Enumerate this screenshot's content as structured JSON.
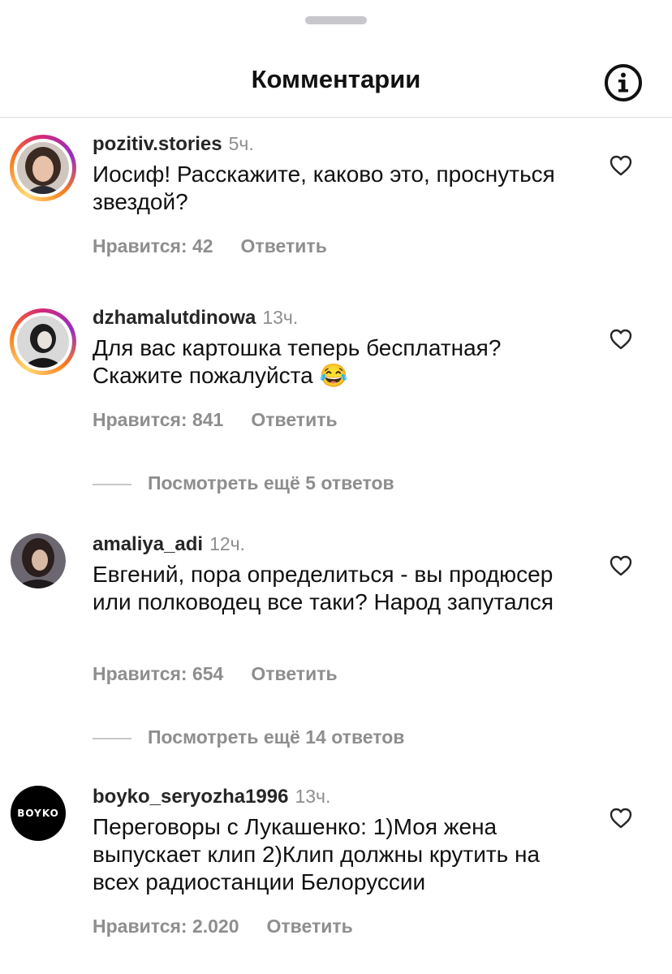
{
  "header": {
    "title": "Комментарии"
  },
  "comments": [
    {
      "username": "pozitiv.stories",
      "time": "5ч.",
      "text": "Иосиф! Расскажите, каково это, проснуться звездой?",
      "likes": "Нравится: 42",
      "reply": "Ответить"
    },
    {
      "username": "dzhamalutdinowa",
      "time": "13ч.",
      "text": "Для вас картошка теперь бесплатная? Скажите пожалуйста 😂",
      "likes": "Нравится: 841",
      "reply": "Ответить",
      "more_replies": "Посмотреть ещё 5 ответов"
    },
    {
      "username": "amaliya_adi",
      "time": "12ч.",
      "text": "Евгений, пора определиться - вы продюсер или полководец все таки? Народ запутался",
      "likes": "Нравится: 654",
      "reply": "Ответить",
      "more_replies": "Посмотреть ещё 14 ответов"
    },
    {
      "username": "boyko_seryozha1996",
      "time": "13ч.",
      "text": "Переговоры с Лукашенко:  1)Моя жена выпускает клип 2)Клип должны крутить на всех радиостанции Белоруссии",
      "likes": "Нравится: 2.020",
      "reply": "Ответить",
      "avatar_logo": "BOYKO"
    }
  ]
}
